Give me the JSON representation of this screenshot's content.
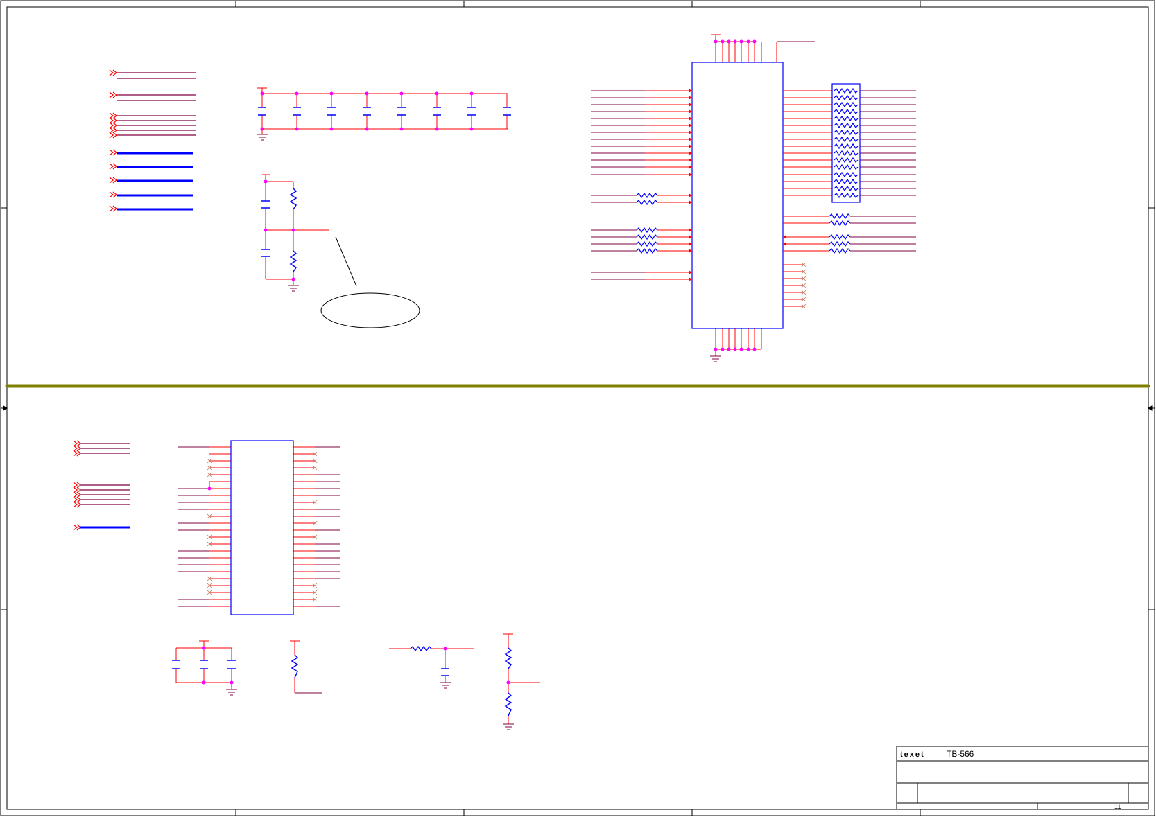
{
  "title_block": {
    "logo_text": "texet",
    "model": "TB-566",
    "page_number": "11"
  },
  "colors": {
    "wire": "#ff0000",
    "net": "#800040",
    "component": "#0000ff",
    "junction": "#ff00ff",
    "separator": "#808000",
    "frame": "#000000"
  }
}
